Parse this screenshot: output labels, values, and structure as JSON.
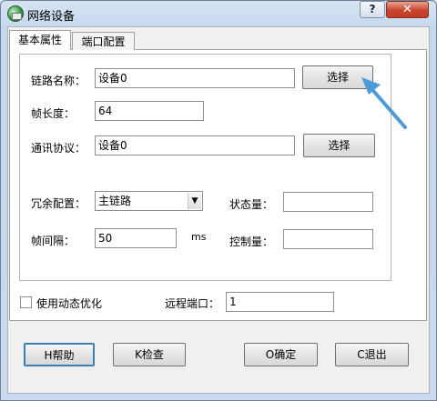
{
  "window": {
    "title": "网络设备",
    "help": "?",
    "close": "✕"
  },
  "tabs": [
    {
      "label": "基本属性"
    },
    {
      "label": "端口配置"
    }
  ],
  "form": {
    "link_name": {
      "label": "链路名称：",
      "value": "设备0",
      "button": "选择"
    },
    "frame_length": {
      "label": "帧长度：",
      "value": "64"
    },
    "protocol": {
      "label": "通讯协议：",
      "value": "设备0",
      "button": "选择"
    },
    "redundancy": {
      "label": "冗余配置：",
      "value": "主链路"
    },
    "status": {
      "label": "状态量：",
      "value": ""
    },
    "frame_interval": {
      "label": "帧间隔：",
      "value": "50",
      "unit": "ms"
    },
    "control": {
      "label": "控制量：",
      "value": ""
    }
  },
  "dynamic_opt": {
    "label": "使用动态优化",
    "checked": false
  },
  "remote_port": {
    "label": "远程端口：",
    "value": "1"
  },
  "footer": {
    "help": "H帮助",
    "check": "K检查",
    "ok": "O确定",
    "cancel": "C退出"
  },
  "colors": {
    "annotation_arrow": "#4f9ad8"
  }
}
